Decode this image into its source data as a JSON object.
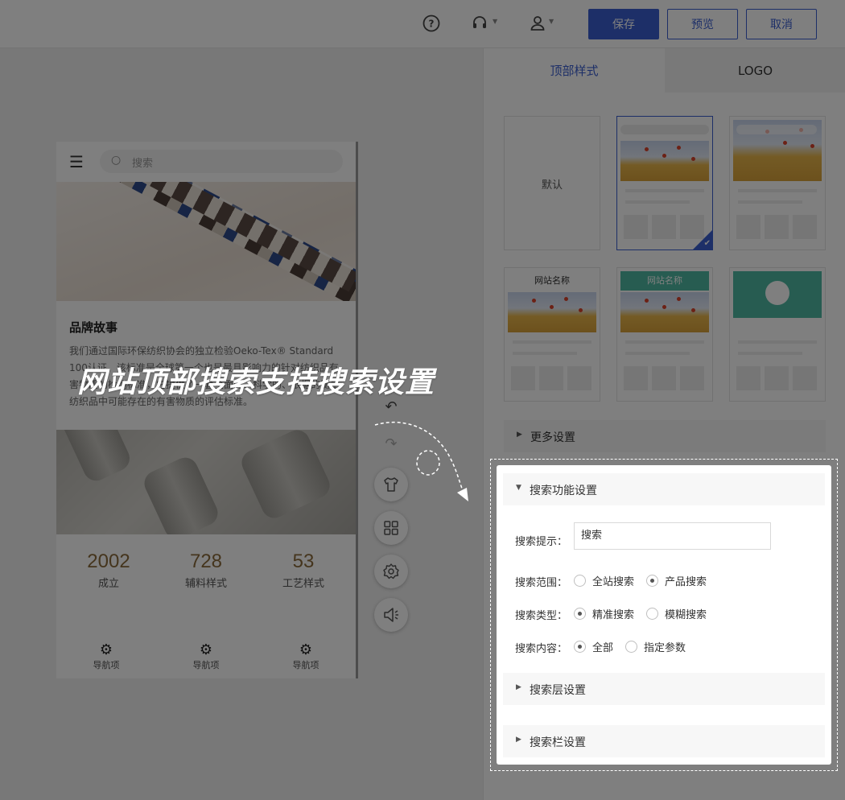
{
  "topbar": {
    "icons": [
      "help-icon",
      "headset-icon",
      "user-icon"
    ],
    "save": "保存",
    "preview": "预览",
    "cancel": "取消"
  },
  "phone": {
    "search_placeholder": "搜索",
    "story_title": "品牌故事",
    "story_text": "我们通过国际环保纺织协会的独立检验Oeko-Tex® Standard 100认证，该标准是全球第一个也是最具影响力的针对纺织品有害物质的检测标准，它提供了一套全面的、科学的、依据的衡量纺织品中可能存在的有害物质的评估标准。",
    "stats": [
      {
        "value": "2002",
        "label": "成立"
      },
      {
        "value": "728",
        "label": "辅料样式"
      },
      {
        "value": "53",
        "label": "工艺样式"
      }
    ],
    "nav": [
      "导航项",
      "导航项",
      "导航项"
    ]
  },
  "tools": [
    "undo-icon",
    "redo-icon",
    "shirt-icon",
    "apps-icon",
    "settings-icon",
    "speaker-icon"
  ],
  "headline": "网站顶部搜索支持搜索设置",
  "panel": {
    "tabs": [
      "顶部样式",
      "LOGO"
    ],
    "active_tab": 0,
    "cards": [
      {
        "label": "默认"
      },
      {
        "label": ""
      },
      {
        "label": ""
      },
      {
        "label": "网站名称"
      },
      {
        "label": "网站名称"
      },
      {
        "label": ""
      }
    ],
    "selected_card": 1,
    "more_settings": "更多设置",
    "search_section": {
      "title": "搜索功能设置",
      "hint_label": "搜索提示：",
      "hint_value": "搜索",
      "range_label": "搜索范围：",
      "range_options": [
        "全站搜索",
        "产品搜索"
      ],
      "range_selected": "产品搜索",
      "type_label": "搜索类型：",
      "type_options": [
        "精准搜索",
        "模糊搜索"
      ],
      "type_selected": "精准搜索",
      "content_label": "搜索内容：",
      "content_options": [
        "全部",
        "指定参数"
      ],
      "content_selected": "全部"
    },
    "layer_settings": "搜索层设置",
    "bar_settings": "搜索栏设置"
  },
  "colors": {
    "accent": "#3a5ed0",
    "teal": "#4fb9a2",
    "stat_number": "#8a6a3a"
  }
}
